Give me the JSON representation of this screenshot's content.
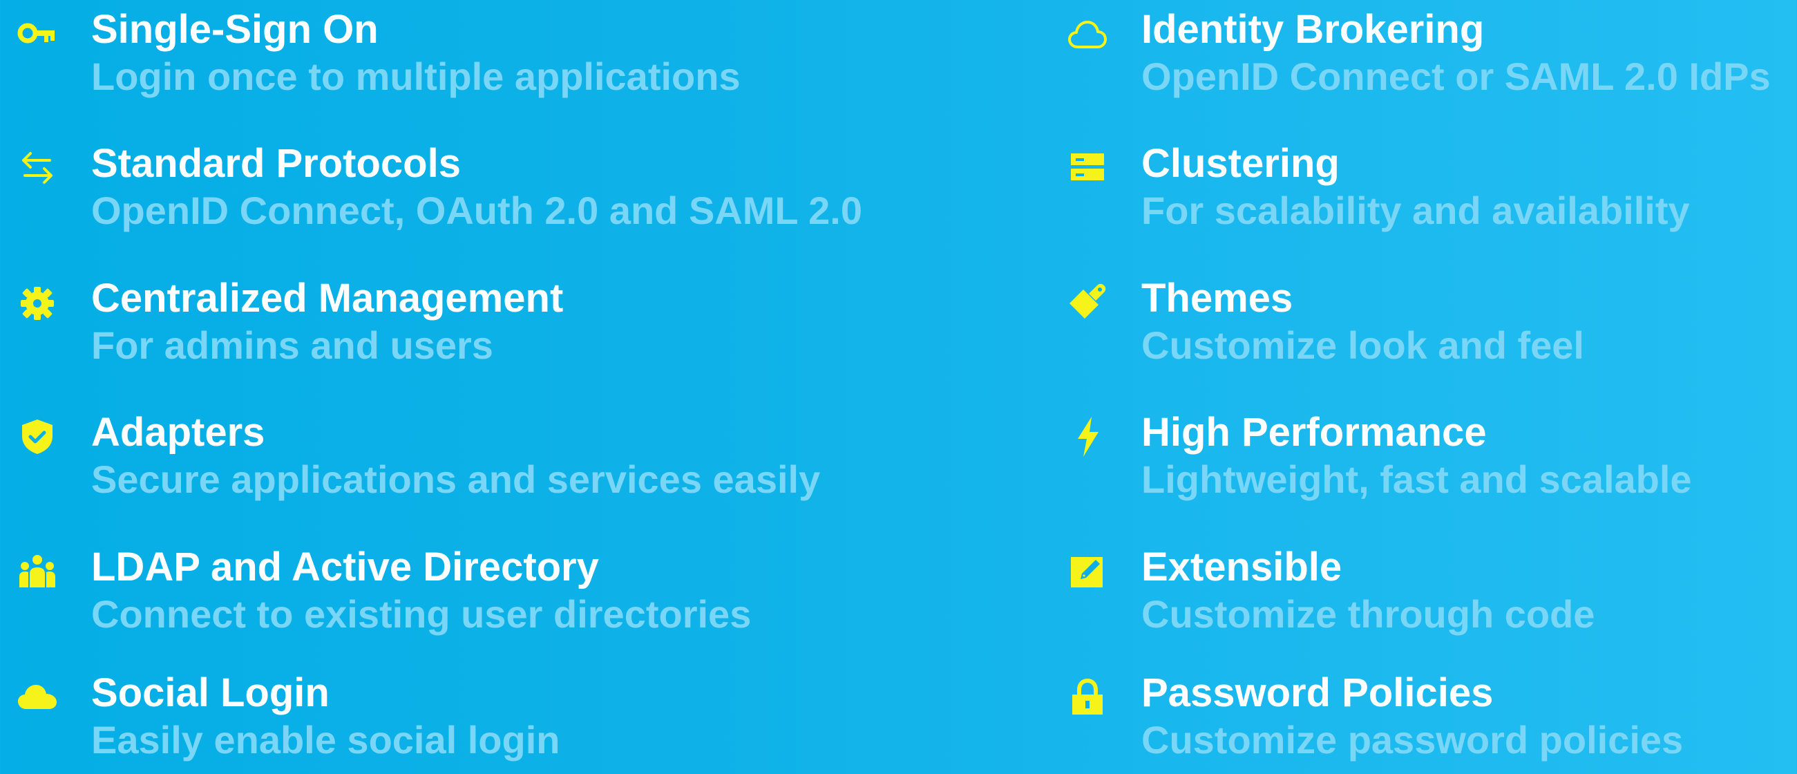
{
  "accent_color": "#f5f31a",
  "features": {
    "left": [
      {
        "icon": "key-icon",
        "title": "Single-Sign On",
        "desc": "Login once to multiple applications"
      },
      {
        "icon": "swap-arrows-icon",
        "title": "Standard Protocols",
        "desc": "OpenID Connect, OAuth 2.0 and SAML 2.0"
      },
      {
        "icon": "gear-icon",
        "title": "Centralized Management",
        "desc": "For admins and users"
      },
      {
        "icon": "shield-check-icon",
        "title": "Adapters",
        "desc": "Secure applications and services easily"
      },
      {
        "icon": "users-icon",
        "title": "LDAP and Active Directory",
        "desc": "Connect to existing user directories"
      },
      {
        "icon": "cloud-icon",
        "title": "Social Login",
        "desc": "Easily enable social login"
      }
    ],
    "right": [
      {
        "icon": "cloud-outline-icon",
        "title": "Identity Brokering",
        "desc": "OpenID Connect or SAML 2.0 IdPs"
      },
      {
        "icon": "server-icon",
        "title": "Clustering",
        "desc": "For scalability and availability"
      },
      {
        "icon": "paint-brush-icon",
        "title": "Themes",
        "desc": "Customize look and feel"
      },
      {
        "icon": "lightning-icon",
        "title": "High Performance",
        "desc": "Lightweight, fast and scalable"
      },
      {
        "icon": "edit-icon",
        "title": "Extensible",
        "desc": "Customize through code"
      },
      {
        "icon": "lock-icon",
        "title": "Password Policies",
        "desc": "Customize password policies"
      }
    ]
  }
}
